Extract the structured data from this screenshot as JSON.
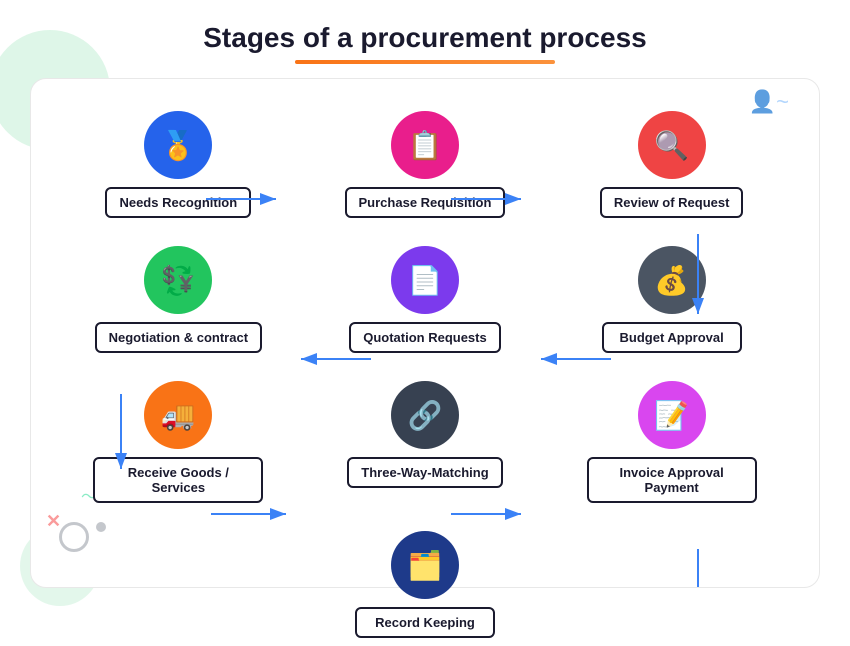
{
  "title": "Stages of a procurement process",
  "nodes": {
    "row1": [
      {
        "id": "needs-recognition",
        "label": "Needs Recognition",
        "color": "circle-blue",
        "icon": "🏅"
      },
      {
        "id": "purchase-requisition",
        "label": "Purchase Requisition",
        "color": "circle-pink",
        "icon": "📋"
      },
      {
        "id": "review-of-request",
        "label": "Review of Request",
        "color": "circle-red",
        "icon": "🔍"
      }
    ],
    "row2": [
      {
        "id": "negotiation-contract",
        "label": "Negotiation & contract",
        "color": "circle-green",
        "icon": "💱"
      },
      {
        "id": "quotation-requests",
        "label": "Quotation Requests",
        "color": "circle-purple",
        "icon": "📄"
      },
      {
        "id": "budget-approval",
        "label": "Budget Approval",
        "color": "circle-darkgray",
        "icon": "💰"
      }
    ],
    "row3": [
      {
        "id": "receive-goods",
        "label": "Receive Goods / Services",
        "color": "circle-orange",
        "icon": "🚚"
      },
      {
        "id": "three-way-matching",
        "label": "Three-Way-Matching",
        "color": "circle-darkblue-gray",
        "icon": "🔗"
      },
      {
        "id": "invoice-approval",
        "label": "Invoice Approval Payment",
        "color": "circle-magenta",
        "icon": "📝"
      }
    ],
    "row4": [
      {
        "id": "record-keeping",
        "label": "Record Keeping",
        "color": "circle-navy",
        "icon": "🗂️"
      }
    ]
  },
  "colors": {
    "arrow": "#3b82f6",
    "border": "#1a1a2e"
  }
}
